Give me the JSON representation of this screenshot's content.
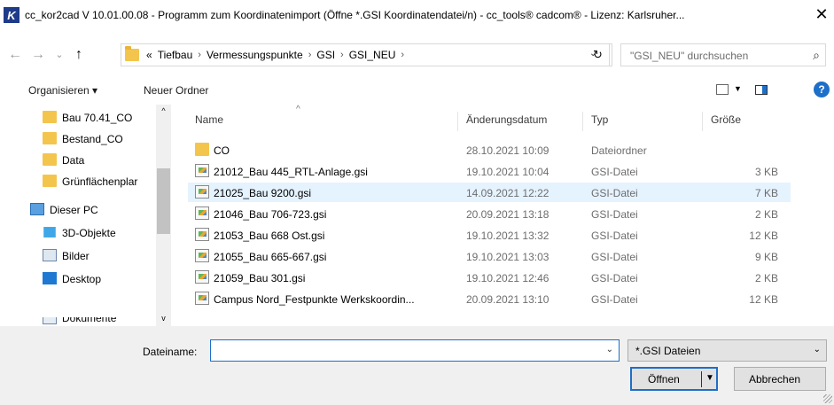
{
  "window": {
    "title": "cc_kor2cad V 10.01.00.08 - Programm zum Koordinatenimport (Öffne *.GSI Koordinatendatei/n) - cc_tools® cadcom® - Lizenz: Karlsruher...",
    "app_icon_letter": "K",
    "close_symbol": "✕"
  },
  "nav": {
    "back": "←",
    "forward": "→",
    "recent": "⌄",
    "up": "↑",
    "crumb_prefix": "«",
    "crumbs": [
      "Tiefbau",
      "Vermessungspunkte",
      "GSI",
      "GSI_NEU"
    ],
    "separator": "›",
    "refresh": "↻",
    "search_placeholder": "\"GSI_NEU\" durchsuchen",
    "search_icon": "⌕"
  },
  "toolbar": {
    "organize": "Organisieren ▾",
    "new_folder": "Neuer Ordner",
    "help": "?"
  },
  "sidebar": {
    "items": [
      {
        "label": "Bau 70.41_CO",
        "icon": "folder-icon"
      },
      {
        "label": "Bestand_CO",
        "icon": "folder-icon"
      },
      {
        "label": "Data",
        "icon": "folder-icon"
      },
      {
        "label": "Grünflächenplar",
        "icon": "folder-icon"
      },
      {
        "label": "Dieser PC",
        "icon": "pc-icon"
      },
      {
        "label": "3D-Objekte",
        "icon": "cube-icon"
      },
      {
        "label": "Bilder",
        "icon": "pictures-icon"
      },
      {
        "label": "Desktop",
        "icon": "desktop-icon"
      },
      {
        "label": "Dokumente",
        "icon": "documents-icon"
      }
    ]
  },
  "columns": {
    "name": "Name",
    "date": "Änderungsdatum",
    "type": "Typ",
    "size": "Größe"
  },
  "files": [
    {
      "name": "CO",
      "date": "28.10.2021 10:09",
      "type": "Dateiordner",
      "size": "",
      "kind": "folder"
    },
    {
      "name": "21012_Bau 445_RTL-Anlage.gsi",
      "date": "19.10.2021 10:04",
      "type": "GSI-Datei",
      "size": "3 KB",
      "kind": "file"
    },
    {
      "name": "21025_Bau 9200.gsi",
      "date": "14.09.2021 12:22",
      "type": "GSI-Datei",
      "size": "7 KB",
      "kind": "file"
    },
    {
      "name": "21046_Bau 706-723.gsi",
      "date": "20.09.2021 13:18",
      "type": "GSI-Datei",
      "size": "2 KB",
      "kind": "file"
    },
    {
      "name": "21053_Bau 668 Ost.gsi",
      "date": "19.10.2021 13:32",
      "type": "GSI-Datei",
      "size": "12 KB",
      "kind": "file"
    },
    {
      "name": "21055_Bau 665-667.gsi",
      "date": "19.10.2021 13:03",
      "type": "GSI-Datei",
      "size": "9 KB",
      "kind": "file"
    },
    {
      "name": "21059_Bau 301.gsi",
      "date": "19.10.2021 12:46",
      "type": "GSI-Datei",
      "size": "2 KB",
      "kind": "file"
    },
    {
      "name": "Campus Nord_Festpunkte Werkskoordin...",
      "date": "20.09.2021 13:10",
      "type": "GSI-Datei",
      "size": "12 KB",
      "kind": "file"
    }
  ],
  "footer": {
    "filename_label": "Dateiname:",
    "filename_value": "",
    "filetype_value": "*.GSI Dateien",
    "open_label": "Öffnen",
    "cancel_label": "Abbrechen"
  }
}
